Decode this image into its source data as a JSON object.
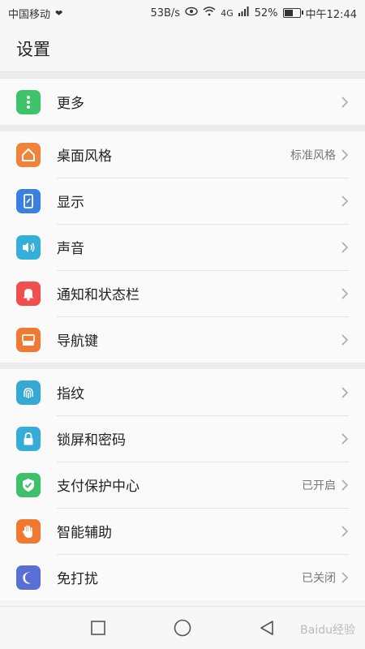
{
  "statusbar": {
    "carrier": "中国移动",
    "speed": "53B/s",
    "signal_tag": "4G",
    "battery": "52%",
    "time": "中午12:44"
  },
  "header": {
    "title": "设置"
  },
  "groups": [
    {
      "items": [
        {
          "label": "更多",
          "icon": "dots-vertical-icon",
          "color": "#3dc46b",
          "value": ""
        }
      ]
    },
    {
      "items": [
        {
          "label": "桌面风格",
          "icon": "home-icon",
          "color": "#f0823a",
          "value": "标准风格"
        },
        {
          "label": "显示",
          "icon": "display-icon",
          "color": "#3b7fe0",
          "value": ""
        },
        {
          "label": "声音",
          "icon": "speaker-icon",
          "color": "#34b0d8",
          "value": ""
        },
        {
          "label": "通知和状态栏",
          "icon": "bell-icon",
          "color": "#ef4f4f",
          "value": ""
        },
        {
          "label": "导航键",
          "icon": "navigation-key-icon",
          "color": "#f07a32",
          "value": ""
        }
      ]
    },
    {
      "items": [
        {
          "label": "指纹",
          "icon": "fingerprint-icon",
          "color": "#35a9d4",
          "value": ""
        },
        {
          "label": "锁屏和密码",
          "icon": "lock-icon",
          "color": "#36acd6",
          "value": ""
        },
        {
          "label": "支付保护中心",
          "icon": "shield-check-icon",
          "color": "#3dc06a",
          "value": "已开启"
        },
        {
          "label": "智能辅助",
          "icon": "hand-icon",
          "color": "#f0782f",
          "value": ""
        },
        {
          "label": "免打扰",
          "icon": "moon-icon",
          "color": "#5a6fd6",
          "value": "已关闭"
        }
      ]
    }
  ],
  "watermark": "Baidu经验"
}
